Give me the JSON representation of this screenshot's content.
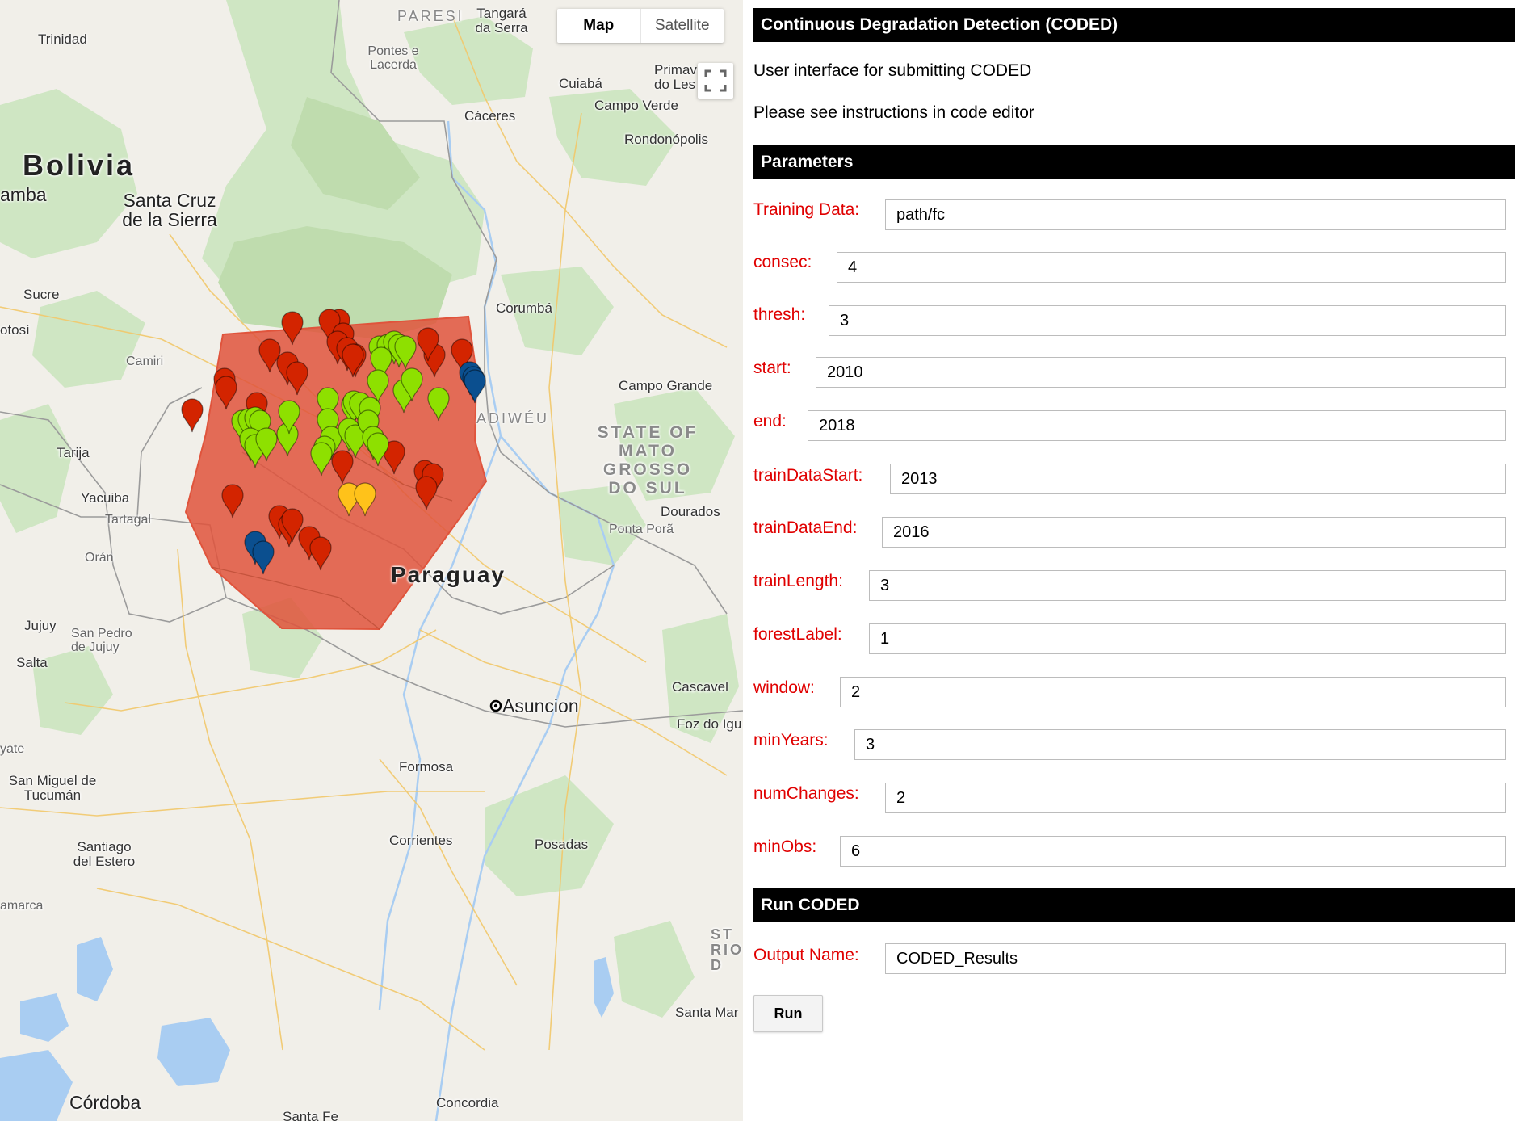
{
  "map": {
    "type_control": {
      "map_label": "Map",
      "satellite_label": "Satellite"
    },
    "labels": {
      "bolivia": "Bolivia",
      "paraguay": "Paraguay",
      "state_ms": "STATE OF MATO GROSSO DO SUL",
      "trinidad": "Trinidad",
      "paresi": "PARESI",
      "tangara": "Tangará da Serra",
      "pontes": "Pontes e Lacerda",
      "cuiaba": "Cuiabá",
      "primavera": "Primav do Les",
      "campo_verde": "Campo Verde",
      "caceres": "Cáceres",
      "rondonopolis": "Rondonópolis",
      "amba": "amba",
      "santa_cruz": "Santa Cruz de la Sierra",
      "sucre": "Sucre",
      "potosi": "otosí",
      "camiri": "Camiri",
      "corumba": "Corumbá",
      "campo_grande": "Campo Grande",
      "kadiweu": "ADIWÉU",
      "tarija": "Tarija",
      "yacuiba": "Yacuiba",
      "tartagal": "Tartagal",
      "oran": "Orán",
      "dourados": "Dourados",
      "ponta_pora": "Ponta Porã",
      "jujuy": "Jujuy",
      "san_pedro": "San Pedro de Jujuy",
      "salta": "Salta",
      "cascavel": "Cascavel",
      "asuncion": "Asuncion",
      "foz": "Foz do Igu",
      "yate": "yate",
      "san_miguel": "San Miguel de Tucumán",
      "formosa": "Formosa",
      "corrientes": "Corrientes",
      "posadas": "Posadas",
      "santiago": "Santiago del Estero",
      "amarca": "amarca",
      "rio": "ST RIO D",
      "santa_mar": "Santa Mar",
      "cordoba": "Córdoba",
      "concordia": "Concordia",
      "santa_fe": "Santa Fe"
    },
    "polygon_color": "#e0543c",
    "marker_colors": {
      "red": "#d32400",
      "green": "#8ee000",
      "yellow": "#ffc21a",
      "blue": "#0b4f8f"
    },
    "icons": {
      "fullscreen": "fullscreen-icon"
    }
  },
  "panel": {
    "title": "Continuous Degradation Detection (CODED)",
    "intro": "User interface for submitting CODED",
    "instructions": "Please see instructions in code editor",
    "params_header": "Parameters",
    "params": [
      {
        "label": "Training Data:",
        "value": "path/fc"
      },
      {
        "label": "consec:",
        "value": "4"
      },
      {
        "label": "thresh:",
        "value": "3"
      },
      {
        "label": "start:",
        "value": "2010"
      },
      {
        "label": "end:",
        "value": "2018"
      },
      {
        "label": "trainDataStart:",
        "value": "2013"
      },
      {
        "label": "trainDataEnd:",
        "value": "2016"
      },
      {
        "label": "trainLength:",
        "value": "3"
      },
      {
        "label": "forestLabel:",
        "value": "1"
      },
      {
        "label": "window:",
        "value": "2"
      },
      {
        "label": "minYears:",
        "value": "3"
      },
      {
        "label": "numChanges:",
        "value": "2"
      },
      {
        "label": "minObs:",
        "value": "6"
      }
    ],
    "run_header": "Run CODED",
    "output_label": "Output Name:",
    "output_value": "CODED_Results",
    "run_button": "Run"
  }
}
